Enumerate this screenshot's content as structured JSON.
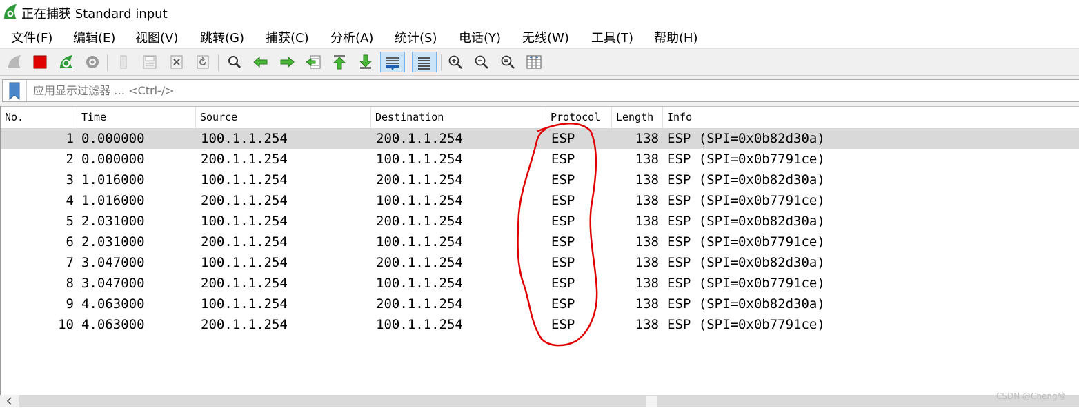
{
  "window": {
    "title": "正在捕获 Standard input"
  },
  "menu": [
    {
      "label": "文件(F)"
    },
    {
      "label": "编辑(E)"
    },
    {
      "label": "视图(V)"
    },
    {
      "label": "跳转(G)"
    },
    {
      "label": "捕获(C)"
    },
    {
      "label": "分析(A)"
    },
    {
      "label": "统计(S)"
    },
    {
      "label": "电话(Y)"
    },
    {
      "label": "无线(W)"
    },
    {
      "label": "工具(T)"
    },
    {
      "label": "帮助(H)"
    }
  ],
  "toolbar": {
    "icons": [
      "start-capture-icon",
      "stop-capture-icon",
      "restart-capture-icon",
      "capture-options-icon",
      "open-file-icon",
      "save-file-icon",
      "close-file-icon",
      "reload-file-icon",
      "find-packet-icon",
      "go-back-icon",
      "go-forward-icon",
      "go-to-packet-icon",
      "go-first-packet-icon",
      "go-last-packet-icon",
      "auto-scroll-icon",
      "colorize-icon",
      "zoom-in-icon",
      "zoom-out-icon",
      "zoom-normal-icon",
      "resize-columns-icon"
    ]
  },
  "filter": {
    "placeholder": "应用显示过滤器 … <Ctrl-/>",
    "value": ""
  },
  "packet_list": {
    "columns": [
      "No.",
      "Time",
      "Source",
      "Destination",
      "Protocol",
      "Length",
      "Info"
    ],
    "rows": [
      {
        "no": "1",
        "time": "0.000000",
        "source": "100.1.1.254",
        "destination": "200.1.1.254",
        "protocol": "ESP",
        "length": "138",
        "info": "ESP (SPI=0x0b82d30a)"
      },
      {
        "no": "2",
        "time": "0.000000",
        "source": "200.1.1.254",
        "destination": "100.1.1.254",
        "protocol": "ESP",
        "length": "138",
        "info": "ESP (SPI=0x0b7791ce)"
      },
      {
        "no": "3",
        "time": "1.016000",
        "source": "100.1.1.254",
        "destination": "200.1.1.254",
        "protocol": "ESP",
        "length": "138",
        "info": "ESP (SPI=0x0b82d30a)"
      },
      {
        "no": "4",
        "time": "1.016000",
        "source": "200.1.1.254",
        "destination": "100.1.1.254",
        "protocol": "ESP",
        "length": "138",
        "info": "ESP (SPI=0x0b7791ce)"
      },
      {
        "no": "5",
        "time": "2.031000",
        "source": "100.1.1.254",
        "destination": "200.1.1.254",
        "protocol": "ESP",
        "length": "138",
        "info": "ESP (SPI=0x0b82d30a)"
      },
      {
        "no": "6",
        "time": "2.031000",
        "source": "200.1.1.254",
        "destination": "100.1.1.254",
        "protocol": "ESP",
        "length": "138",
        "info": "ESP (SPI=0x0b7791ce)"
      },
      {
        "no": "7",
        "time": "3.047000",
        "source": "100.1.1.254",
        "destination": "200.1.1.254",
        "protocol": "ESP",
        "length": "138",
        "info": "ESP (SPI=0x0b82d30a)"
      },
      {
        "no": "8",
        "time": "3.047000",
        "source": "200.1.1.254",
        "destination": "100.1.1.254",
        "protocol": "ESP",
        "length": "138",
        "info": "ESP (SPI=0x0b7791ce)"
      },
      {
        "no": "9",
        "time": "4.063000",
        "source": "100.1.1.254",
        "destination": "200.1.1.254",
        "protocol": "ESP",
        "length": "138",
        "info": "ESP (SPI=0x0b82d30a)"
      },
      {
        "no": "10",
        "time": "4.063000",
        "source": "200.1.1.254",
        "destination": "100.1.1.254",
        "protocol": "ESP",
        "length": "138",
        "info": "ESP (SPI=0x0b7791ce)"
      }
    ],
    "selected_row": 0
  },
  "annotation": {
    "color": "#e00000"
  },
  "watermark": "CSDN @Cheng兮",
  "colors": {
    "selected_row": "#d9d9d9",
    "toolbar_bg": "#f0f0f0",
    "active_button": "#cce4f7"
  }
}
